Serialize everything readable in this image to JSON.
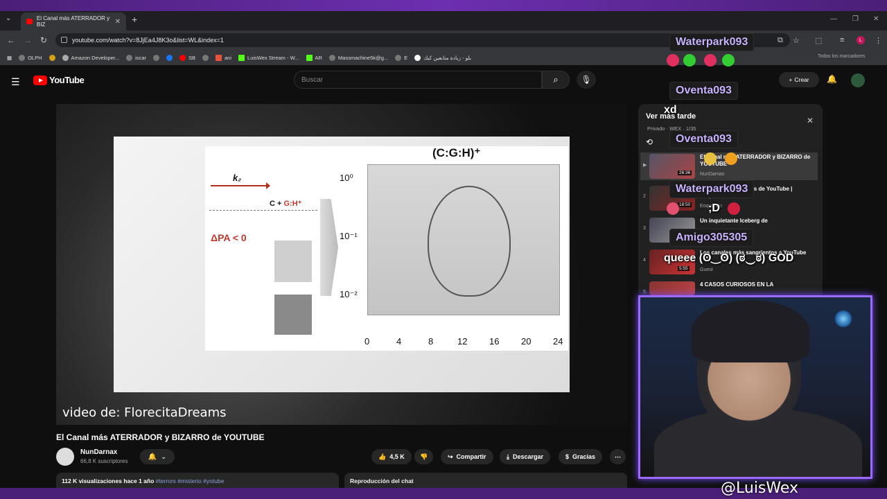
{
  "browser": {
    "tab_title": "El Canal más ATERRADOR y BIZ",
    "url": "youtube.com/watch?v=8JjEa4J8K3o&list=WL&index=1",
    "bookmarks": [
      "OLPH",
      "Amazon Developer...",
      "iscar",
      "SB",
      "ani",
      "LuisWex Stream - W...",
      "AR",
      "Massmachine5k@g...",
      "E",
      "بلو - زيادة متابعين كيك"
    ],
    "bookmarks_right": "Todos los marcadores",
    "profile_initial": "L"
  },
  "youtube": {
    "logo": "YouTube",
    "search_placeholder": "Buscar",
    "create_label": "Crear"
  },
  "video": {
    "formula": "(C:G:H)⁺",
    "k2": "k₂",
    "cgh_c": "C + ",
    "cgh_g": "G:H⁺",
    "dpa": "ΔPA < 0",
    "y_ticks": [
      "10⁰",
      "10⁻¹",
      "10⁻²"
    ],
    "x_ticks": [
      "0",
      "4",
      "8",
      "12",
      "16",
      "20",
      "24"
    ],
    "credit": "video de: FlorecitaDreams",
    "title": "El Canal más ATERRADOR y BIZARRO de YOUTUBE",
    "channel": "NunDarnax",
    "subscribers": "66,8 K suscriptores",
    "likes": "4,5 K",
    "share": "Compartir",
    "download": "Descargar",
    "thanks": "Gracias",
    "views": "112 K visualizaciones",
    "age": "hace 1 año",
    "tags": "#terrors #misterio #yotube",
    "chat_replay": "Reproducción del chat"
  },
  "playlist": {
    "title": "Ver más tarde",
    "meta": "Privado · WEX · 1/35",
    "items": [
      {
        "num": "▶",
        "title": "El Canal más ATERRADOR y BIZARRO de YOUTUBE",
        "channel": "NunDarnax",
        "duration": "26:36"
      },
      {
        "num": "2",
        "title": "Los videos más raros de YouTube | Eoquendo",
        "channel": "Eoquendo",
        "duration": "18:50"
      },
      {
        "num": "3",
        "title": "Un inquietante Iceberg de",
        "channel": "",
        "duration": ""
      },
      {
        "num": "4",
        "title": "Los canales más sangrientos a YouTube",
        "channel": "Guest",
        "duration": "5:55"
      },
      {
        "num": "5",
        "title": "4 CASOS CURIOSOS EN LA",
        "channel": "",
        "duration": ""
      }
    ]
  },
  "chat": [
    {
      "user": "Waterpark093",
      "msg": ""
    },
    {
      "user": "Oventa093",
      "msg": "xd"
    },
    {
      "user": "Oventa093",
      "msg": ""
    },
    {
      "user": "Waterpark093",
      "msg": ";D"
    },
    {
      "user": "Amigo305305",
      "msg": "queee (ʘ‿ʘ) (ಠ‿ಠ) GOD"
    }
  ],
  "stream": {
    "handle": "@LuisWex"
  },
  "colors": {
    "accent_purple": "#9b6bff",
    "youtube_red": "#ff0000",
    "chat_name": "#c9b3ff"
  }
}
